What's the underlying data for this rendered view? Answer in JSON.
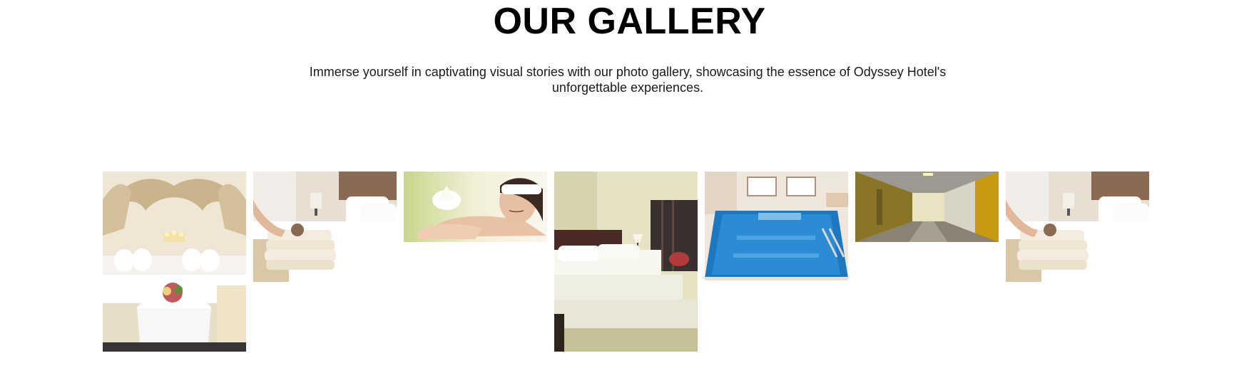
{
  "section": {
    "title": "OUR GALLERY",
    "subtitle": "Immerse yourself in captivating visual stories with our photo gallery, showcasing the essence of Odyssey Hotel's unforgettable experiences."
  },
  "gallery": {
    "photos": [
      {
        "subject": "ornate-bedroom-photo"
      },
      {
        "subject": "towels-on-bed-photo"
      },
      {
        "subject": "spa-massage-photo"
      },
      {
        "subject": "hotel-bedroom-photo"
      },
      {
        "subject": "indoor-pool-photo"
      },
      {
        "subject": "hotel-corridor-photo"
      },
      {
        "subject": "towels-on-bed-photo"
      }
    ]
  },
  "colors": {
    "background": "#ffffff",
    "title": "#000000",
    "text": "#1a1a1a"
  }
}
